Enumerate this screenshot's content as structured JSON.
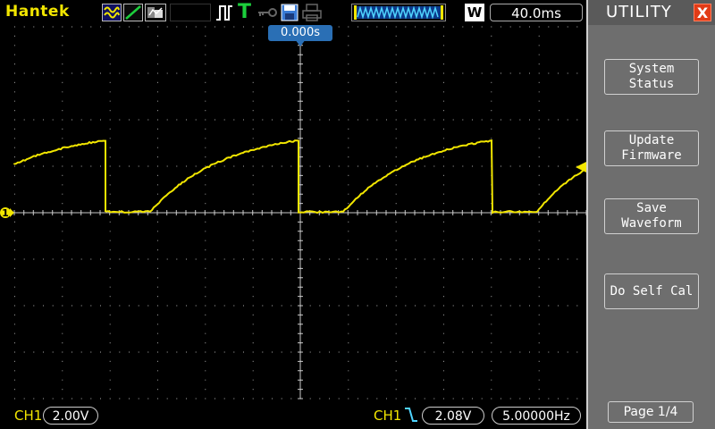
{
  "header": {
    "brand": "Hantek",
    "timebase": "40.0ms",
    "w_label": "W",
    "trigger_t": "T"
  },
  "screen": {
    "time_offset": "0.000s",
    "ch1_marker": "1"
  },
  "menu": {
    "title": "UTILITY",
    "close": "X",
    "items": [
      {
        "label": "System\nStatus"
      },
      {
        "label": "Update\nFirmware"
      },
      {
        "label": "Save\nWaveform"
      },
      {
        "label": "Do Self Cal"
      }
    ],
    "page": "Page 1/4"
  },
  "bottom": {
    "ch1_label": "CH1",
    "ch1_scale": "2.00V",
    "trig_channel": "CH1",
    "trig_level": "2.08V",
    "frequency": "5.00000Hz"
  },
  "colors": {
    "trace": "#f2e600",
    "grid": "#8a8a8a",
    "menu_bg": "#6e6e6e",
    "accent_blue": "#2a6fb5",
    "close_red": "#e23b16"
  }
}
